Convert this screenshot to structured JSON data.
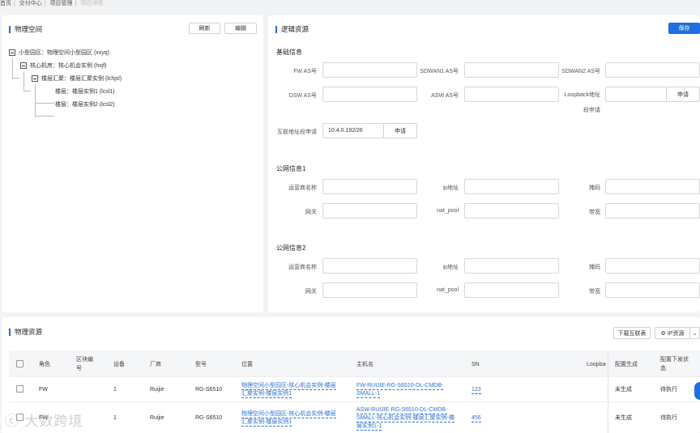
{
  "breadcrumb": {
    "items": [
      "首页",
      "交付中心",
      "项目管理"
    ],
    "current": "项目详情"
  },
  "physical_space": {
    "title": "物理空间",
    "refresh_label": "刷新",
    "edit_label": "编辑",
    "tree": [
      "小型园区：物理空间小型园区 (xxyq)",
      "核心机房：核心机会实例 (hxjf)",
      "楼层汇聚：楼层汇聚实例 (lchjsl)",
      "楼层：楼层实例1 (lcsl1)",
      "楼层：楼层实例2 (lcsl2)"
    ]
  },
  "logical_resources": {
    "title": "逻辑资源",
    "save_label": "保存",
    "basic_info": {
      "title": "基础信息",
      "fw_as_label": "FW AS号",
      "fw_as_value": "",
      "sdwan1_as_label": "SDWAN1 AS号",
      "sdwan1_as_value": "",
      "sdwan2_as_label": "SDWAN2 AS号",
      "sdwan2_as_value": "",
      "dsw_as_label": "DSW AS号",
      "dsw_as_value": "",
      "asw_as_label": "ASW AS号",
      "asw_as_value": "",
      "loopback_label_1": "Loopback地址",
      "loopback_label_2": "段申请",
      "loopback_value": "",
      "loopback_apply_label": "申请",
      "interconnect_label": "互联地址段申请",
      "interconnect_value": "10.4.0.192/26",
      "interconnect_apply_label": "申请"
    },
    "public_net_1": {
      "title": "公网信息1",
      "isp_label": "运营商名称",
      "ip_label": "ip地址",
      "mask_label": "掩码",
      "gateway_label": "网关",
      "nat_pool_label": "nat_pool",
      "bandwidth_label": "带宽"
    },
    "public_net_2": {
      "title": "公网信息2",
      "isp_label": "运营商名称",
      "ip_label": "ip地址",
      "mask_label": "掩码",
      "gateway_label": "网关",
      "nat_pool_label": "nat_pool",
      "bandwidth_label": "带宽"
    }
  },
  "physical_resources": {
    "title": "物理资源",
    "download_label": "下载互联表",
    "ip_resource_label": "IP资源",
    "columns": {
      "role": "角色",
      "block_1": "区块编",
      "block_2": "号",
      "device": "设备",
      "vendor": "厂商",
      "model": "型号",
      "location": "位置",
      "hostname": "主机名",
      "sn": "SN",
      "loopback": "Loopbac",
      "config_gen": "配置生成",
      "config_push_1": "配置下发状",
      "config_push_2": "态"
    },
    "rows": [
      {
        "role": "FW",
        "block": "",
        "device": "1",
        "vendor": "Ruijie",
        "model": "RG-S6510",
        "location_1": "物理空间小型园区-核心机会实例-楼层",
        "location_2": "汇聚实例-楼层实例1",
        "hostname_1": "FW-RUIJIE-RG-S6510-DL-CMDB-",
        "hostname_2": "SMALL-1",
        "sn": "123",
        "config_gen": "未生成",
        "config_push": "待执行"
      },
      {
        "role": "FW",
        "block": "",
        "device": "1",
        "vendor": "Ruijie",
        "model": "RG-S6510",
        "location_1": "物理空间小型园区-核心机会实例-楼层",
        "location_2": "汇聚实例-楼层实例1",
        "hostname_1": "ASW-RUIJIE-RG-S6510-DL-CMDB-",
        "hostname_2": "SMALL-核心机会实例-楼层汇聚实例-楼",
        "hostname_3": "层实例1-1",
        "sn": "456",
        "config_gen": "未生成",
        "config_push": "待执行"
      }
    ]
  },
  "watermark": "大数跨境"
}
